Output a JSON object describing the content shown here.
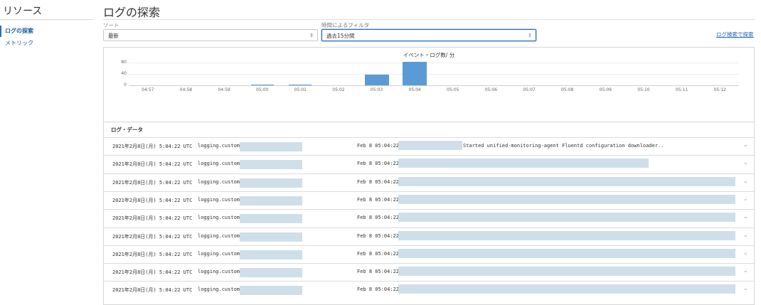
{
  "sidebar": {
    "title": "リソース",
    "items": [
      {
        "label": "ログの探索",
        "active": true
      },
      {
        "label": "メトリック",
        "active": false
      }
    ]
  },
  "page": {
    "title": "ログの探索"
  },
  "sort": {
    "label": "ソート",
    "value": "最新"
  },
  "time_filter": {
    "label": "時間によるフィルタ",
    "value": "過去15分間"
  },
  "search_link": "ログ検索で探索",
  "chart_data": {
    "type": "bar",
    "title": "イベント・ログ数/ 分",
    "categories": [
      "04:57",
      "04:58",
      "04:59",
      "05:00",
      "05:01",
      "05:02",
      "05:03",
      "05:04",
      "05:05",
      "05:06",
      "05:07",
      "05:08",
      "05:09",
      "05:10",
      "05:11",
      "05:12"
    ],
    "values": [
      0,
      0,
      0,
      3,
      3,
      0,
      38,
      82,
      0,
      0,
      0,
      0,
      0,
      0,
      0,
      0
    ],
    "yticks": [
      0,
      40,
      80
    ],
    "ylim": [
      0,
      88
    ],
    "color": "#5b9bd5",
    "grid": true
  },
  "log_section": {
    "title": "ログ・データ",
    "rows": [
      {
        "time": "2021年2月8日(月) 5:04:22 UTC",
        "source": "logging.custom.",
        "msg": "Feb 8 05:04:22",
        "tail": "Started unified-monitoring-agent Fluentd configuration downloader.."
      },
      {
        "time": "2021年2月8日(月) 5:04:22 UTC",
        "source": "logging.custom.",
        "msg": "Feb 8 05:04:22",
        "tail": ""
      },
      {
        "time": "2021年2月8日(月) 5:04:22 UTC",
        "source": "logging.custom.",
        "msg": "Feb 8 05:04:22",
        "tail": ""
      },
      {
        "time": "2021年2月8日(月) 5:04:22 UTC",
        "source": "logging.custom.",
        "msg": "Feb 8 05:04:22",
        "tail": ""
      },
      {
        "time": "2021年2月8日(月) 5:04:22 UTC",
        "source": "logging.custom.",
        "msg": "Feb 8 05:04:22",
        "tail": ""
      },
      {
        "time": "2021年2月8日(月) 5:04:22 UTC",
        "source": "logging.custom.",
        "msg": "Feb 8 05:04:22",
        "tail": ""
      },
      {
        "time": "2021年2月8日(月) 5:04:22 UTC",
        "source": "logging.custom.",
        "msg": "Feb 8 05:04:22",
        "tail": ""
      },
      {
        "time": "2021年2月8日(月) 5:04:22 UTC",
        "source": "logging.custom.",
        "msg": "Feb 8 05:04:22",
        "tail": ""
      },
      {
        "time": "2021年2月8日(月) 5:04:22 UTC",
        "source": "logging.custom.",
        "msg": "Feb 8 05:04:22",
        "tail": ""
      }
    ]
  },
  "icons": {
    "expand": "chevron-down-icon",
    "select": "select-arrows-icon"
  }
}
